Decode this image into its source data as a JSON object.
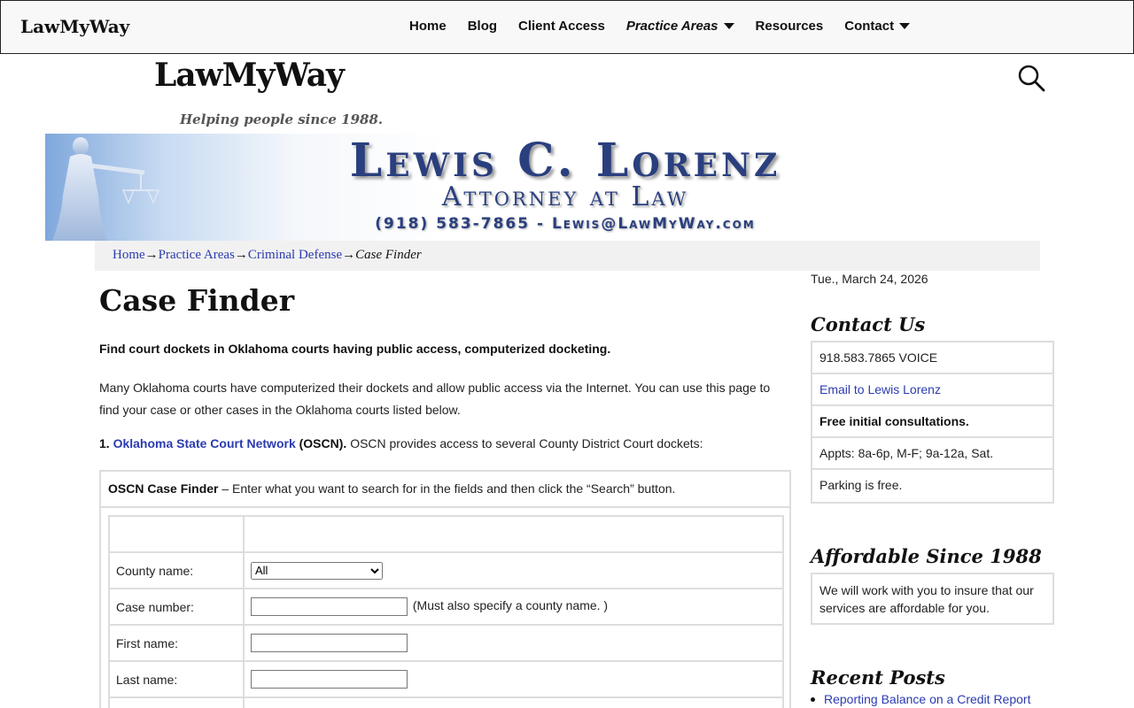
{
  "topbar": {
    "brand": "LawMyWay",
    "nav": [
      {
        "label": "Home"
      },
      {
        "label": "Blog"
      },
      {
        "label": "Client Access"
      },
      {
        "label": "Practice Areas"
      },
      {
        "label": "Resources"
      },
      {
        "label": "Contact"
      }
    ]
  },
  "site": {
    "title": "LawMyWay",
    "tagline": "Helping people since 1988."
  },
  "banner": {
    "name": "Lewis C. Lorenz",
    "subtitle": "Attorney at Law",
    "contact": "(918) 583-7865 - Lewis@LawMyWay.com"
  },
  "breadcrumb": {
    "items": [
      "Home",
      "Practice Areas",
      "Criminal Defense"
    ],
    "arrow": "→",
    "current": "Case Finder"
  },
  "main": {
    "title": "Case Finder",
    "lead": "Find court dockets in Oklahoma courts having public access, computerized docketing.",
    "paragraph": "Many Oklahoma courts have computerized their dockets and allow public access via the Internet. You can use this page to find your case or other cases in the Oklahoma courts listed below.",
    "oscn": {
      "number": "1.",
      "link": "Oklahoma State Court Network",
      "abbr": "(OSCN).",
      "text": "OSCN provides access to several County District Court dockets:"
    },
    "finder": {
      "title": "OSCN Case Finder",
      "instructions": "– Enter what you want to search for in the fields and then click the “Search” button.",
      "fields": {
        "county_label": "County name:",
        "county_value": "All",
        "case_label": "Case number:",
        "case_note": "(Must also specify a county name. )",
        "first_label": "First name:",
        "last_label": "Last name:"
      }
    }
  },
  "sidebar": {
    "date": "Tue., March 24, 2026",
    "contact_heading": "Contact Us",
    "contact_rows": [
      "918.583.7865 VOICE",
      "Email to Lewis Lorenz",
      "Free initial consultations.",
      "Appts: 8a-6p, M-F; 9a-12a, Sat.",
      "Parking is free."
    ],
    "afford_heading": "Affordable Since 1988",
    "afford_text": "We will work with you to insure that our services are affordable for you.",
    "recent_heading": "Recent Posts",
    "recent_posts": [
      "Reporting Balance on a Credit Report"
    ]
  },
  "colors": {
    "link": "#2b3bb0",
    "banner_text": "#2a3f7e",
    "border": "#dddddd"
  }
}
